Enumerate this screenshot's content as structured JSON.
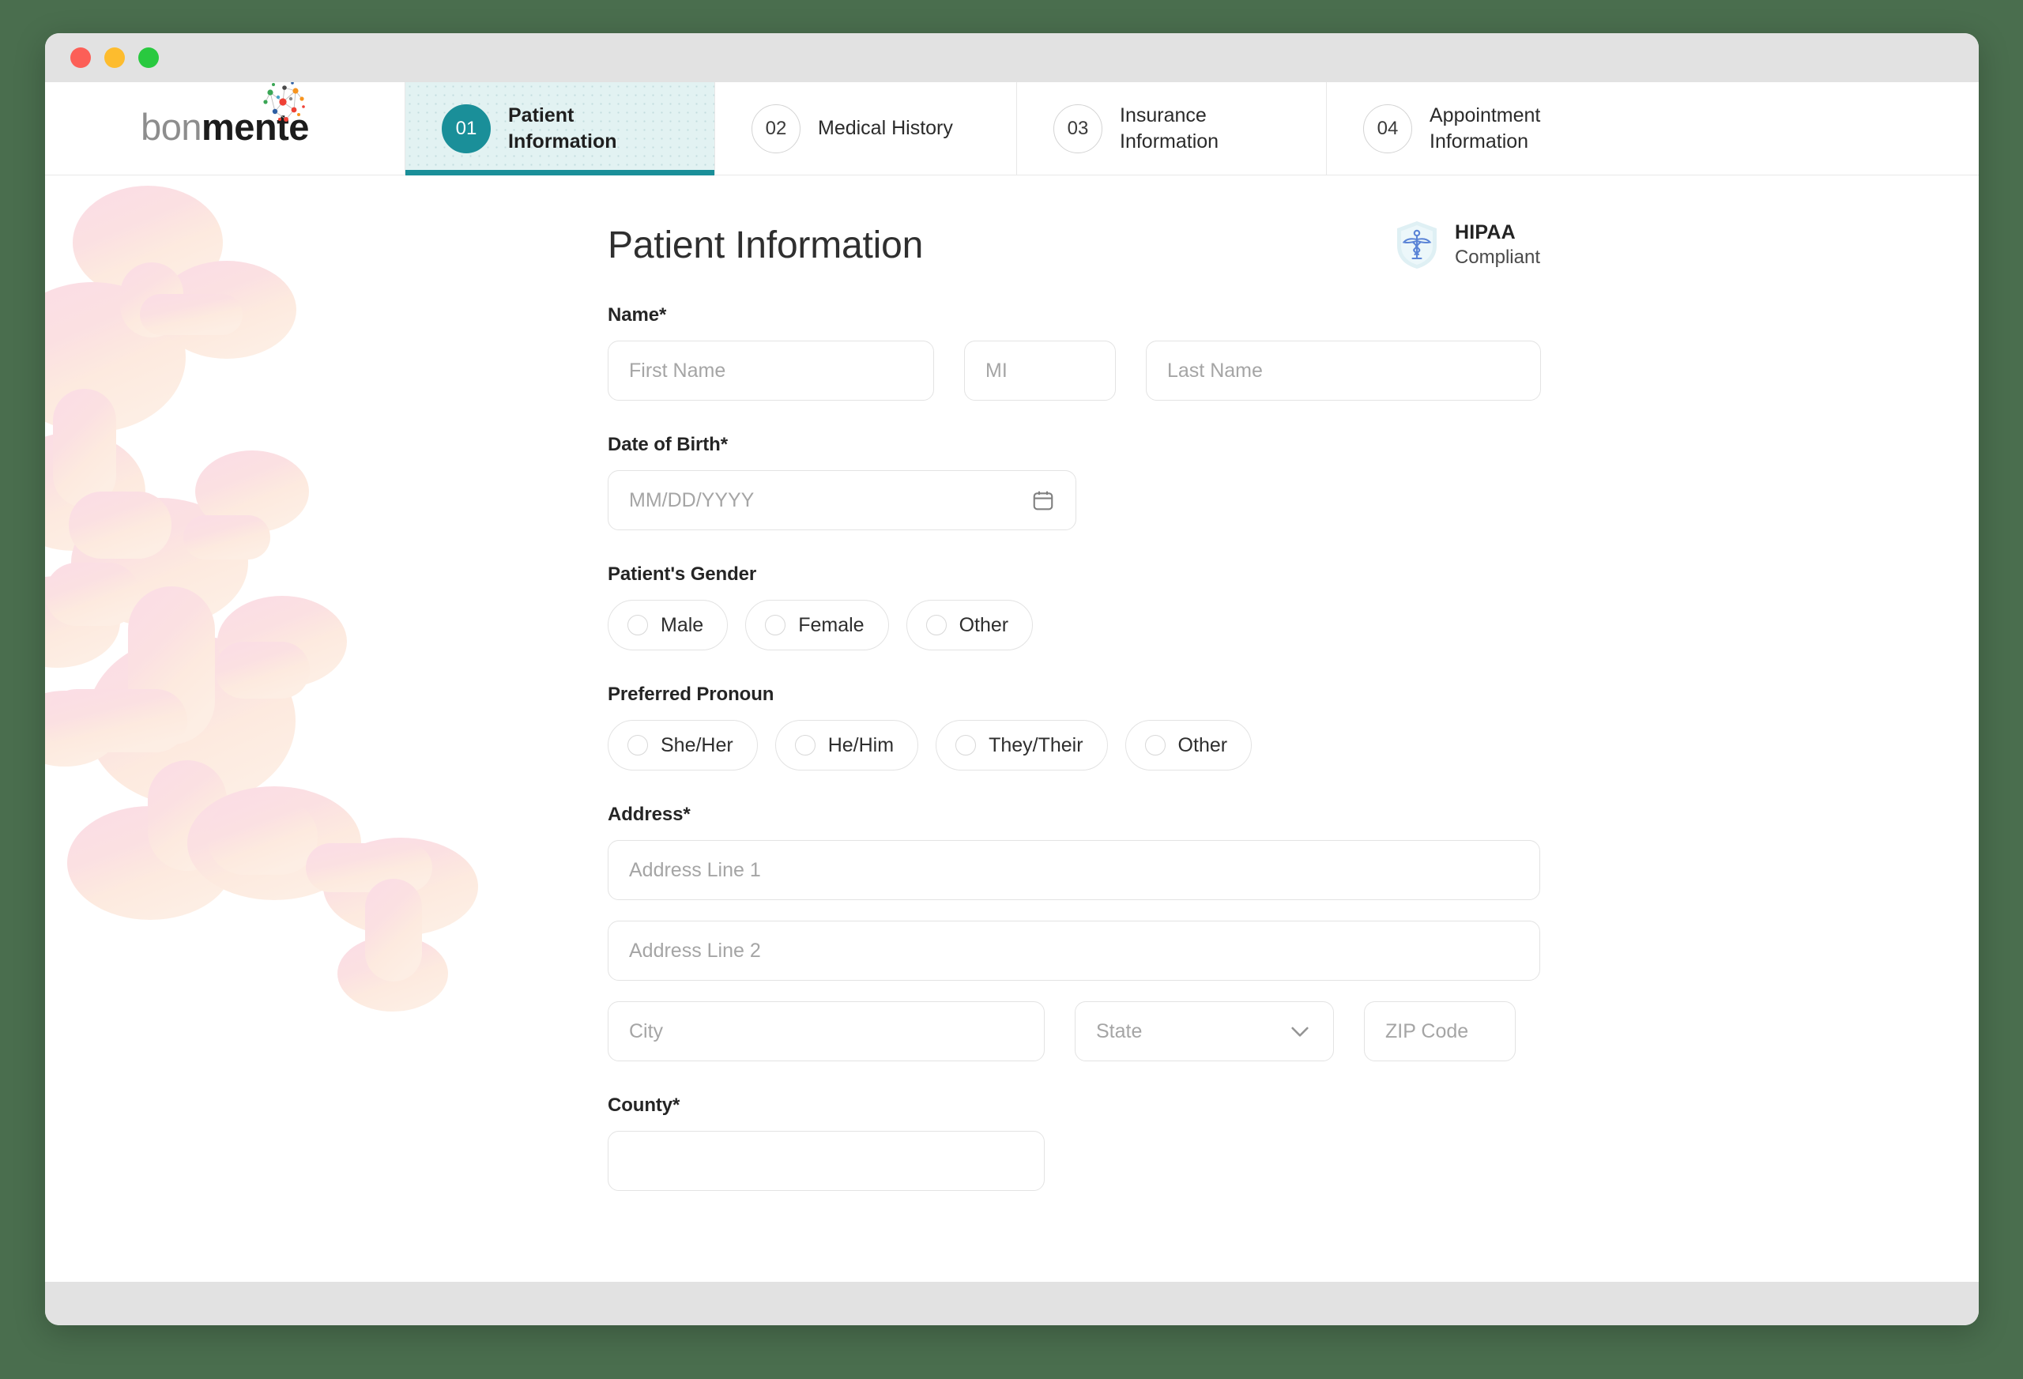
{
  "window": {
    "traffic_lights": [
      "close",
      "minimize",
      "maximize"
    ]
  },
  "brand": {
    "name_light": "bon",
    "name_bold": "mente",
    "logo_mark": "molecule-network-icon"
  },
  "stepper": {
    "steps": [
      {
        "number": "01",
        "label": "Patient\nInformation",
        "active": true
      },
      {
        "number": "02",
        "label": "Medical History",
        "active": false
      },
      {
        "number": "03",
        "label": "Insurance\nInformation",
        "active": false
      },
      {
        "number": "04",
        "label": "Appointment\nInformation",
        "active": false
      }
    ],
    "active_color": "#1a8f99",
    "active_bg": "#e2f2f2"
  },
  "main": {
    "page_title": "Patient Information",
    "hipaa": {
      "title": "HIPAA",
      "subtitle": "Compliant",
      "icon": "shield-caduceus-icon",
      "shield_color": "#dff0f4",
      "symbol_color": "#5b84d6"
    },
    "fields": {
      "name": {
        "label": "Name*",
        "first": {
          "placeholder": "First Name",
          "value": ""
        },
        "mi": {
          "placeholder": "MI",
          "value": ""
        },
        "last": {
          "placeholder": "Last Name",
          "value": ""
        }
      },
      "dob": {
        "label": "Date of Birth*",
        "placeholder": "MM/DD/YYYY",
        "value": "",
        "icon": "calendar-icon"
      },
      "gender": {
        "label": "Patient's Gender",
        "options": [
          "Male",
          "Female",
          "Other"
        ],
        "selected": ""
      },
      "pronoun": {
        "label": "Preferred Pronoun",
        "options": [
          "She/Her",
          "He/Him",
          "They/Their",
          "Other"
        ],
        "selected": ""
      },
      "address": {
        "label": "Address*",
        "line1": {
          "placeholder": "Address Line 1",
          "value": ""
        },
        "line2": {
          "placeholder": "Address Line 2",
          "value": ""
        },
        "city": {
          "placeholder": "City",
          "value": ""
        },
        "state": {
          "placeholder": "State",
          "value": "",
          "icon": "chevron-down-icon"
        },
        "zip": {
          "placeholder": "ZIP Code",
          "value": ""
        }
      },
      "county": {
        "label": "County*",
        "placeholder": "",
        "value": ""
      }
    }
  },
  "theme": {
    "page_bg": "#4a6e4e",
    "chrome_bg": "#e2e2e2",
    "accent": "#1a8f99",
    "border": "#e3e3e3",
    "placeholder": "#a5a5a5"
  }
}
